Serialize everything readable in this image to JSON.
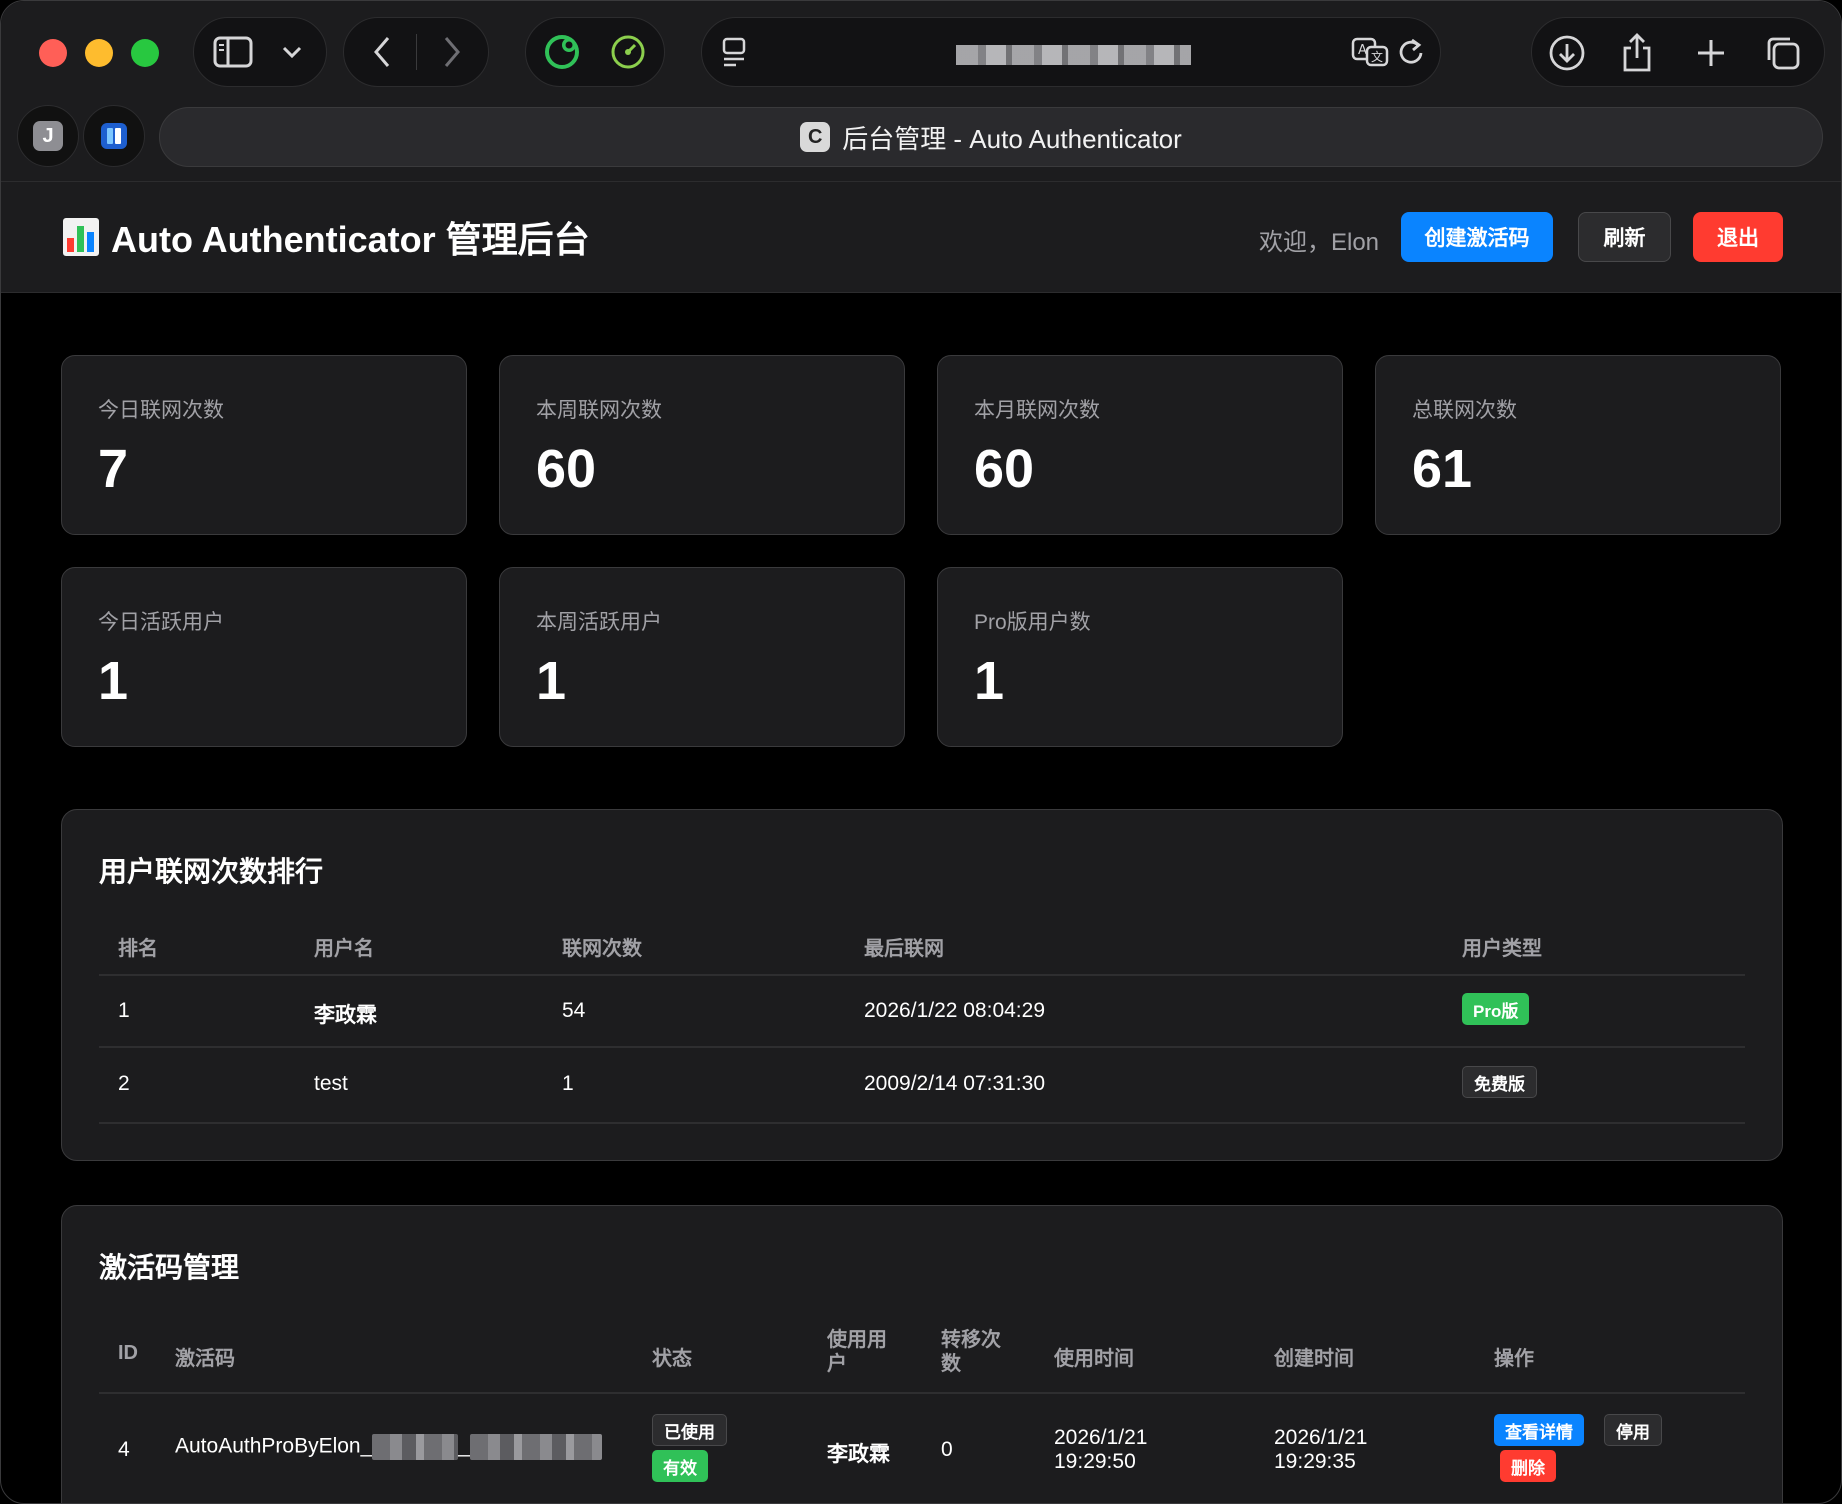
{
  "browser": {
    "tab_title": "后台管理 - Auto Authenticator",
    "favicon_letter": "C",
    "side_tab_letter": "J"
  },
  "header": {
    "title": "Auto Authenticator 管理后台",
    "welcome": "欢迎，Elon",
    "create_code_label": "创建激活码",
    "refresh_label": "刷新",
    "logout_label": "退出"
  },
  "stats": [
    {
      "label": "今日联网次数",
      "value": "7"
    },
    {
      "label": "本周联网次数",
      "value": "60"
    },
    {
      "label": "本月联网次数",
      "value": "60"
    },
    {
      "label": "总联网次数",
      "value": "61"
    },
    {
      "label": "今日活跃用户",
      "value": "1"
    },
    {
      "label": "本周活跃用户",
      "value": "1"
    },
    {
      "label": "Pro版用户数",
      "value": "1"
    }
  ],
  "ranking": {
    "title": "用户联网次数排行",
    "columns": [
      "排名",
      "用户名",
      "联网次数",
      "最后联网",
      "用户类型"
    ],
    "rows": [
      {
        "rank": "1",
        "username": "李政霖",
        "count": "54",
        "last": "2026/1/22 08:04:29",
        "type": "Pro版",
        "type_color": "#30c158"
      },
      {
        "rank": "2",
        "username": "test",
        "count": "1",
        "last": "2009/2/14 07:31:30",
        "type": "免费版",
        "type_color": "#2c2c2e"
      }
    ]
  },
  "codes": {
    "title": "激活码管理",
    "columns": [
      "ID",
      "激活码",
      "状态",
      "使用用户",
      "转移次数",
      "使用时间",
      "创建时间",
      "操作"
    ],
    "rows": [
      {
        "id": "4",
        "code_prefix": "AutoAuthProByElon_",
        "code_sep": "_",
        "status_used": "已使用",
        "status_valid": "有效",
        "user": "李政霖",
        "transfers": "0",
        "used_date": "2026/1/21",
        "used_time": "19:29:50",
        "created_date": "2026/1/21",
        "created_time": "19:29:35",
        "action_view": "查看详情",
        "action_disable": "停用",
        "action_delete": "删除"
      }
    ]
  },
  "colors": {
    "accent_blue": "#0a84ff",
    "success_green": "#30c158",
    "danger_red": "#ff3b30"
  }
}
